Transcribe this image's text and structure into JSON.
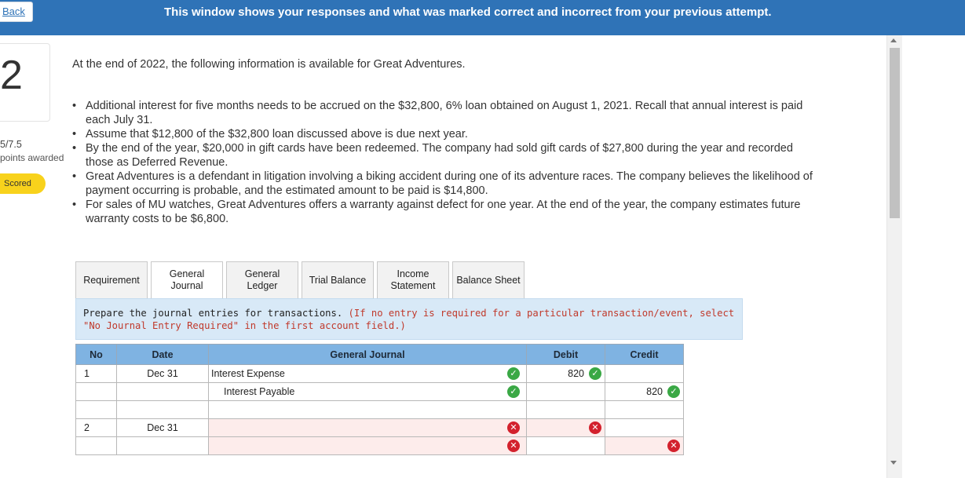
{
  "header": {
    "back_label": "Back",
    "banner": "This window shows your responses and what was marked correct and incorrect from your previous attempt."
  },
  "sidebar": {
    "question_number": "2",
    "score": "5/7.5",
    "points_label": "points awarded",
    "status_badge": "Scored"
  },
  "question": {
    "intro": "At the end of 2022, the following information is available for Great Adventures.",
    "bullets": [
      "Additional interest for five months needs to be accrued on the $32,800, 6% loan obtained on August 1, 2021. Recall that annual interest is paid each July 31.",
      "Assume that $12,800 of the $32,800 loan discussed above is due next year.",
      "By the end of the year, $20,000 in gift cards have been redeemed. The company had sold gift cards of $27,800 during the year and recorded those as Deferred Revenue.",
      "Great Adventures is a defendant in litigation involving a biking accident during one of its adventure races. The company believes the likelihood of payment occurring is probable, and the estimated amount to be paid is $14,800.",
      "For sales of MU watches, Great Adventures offers a warranty against defect for one year. At the end of the year, the company estimates future warranty costs to be $6,800."
    ]
  },
  "tabs": [
    {
      "label": "Requirement"
    },
    {
      "label": "General Journal"
    },
    {
      "label": "General Ledger"
    },
    {
      "label": "Trial Balance"
    },
    {
      "label": "Income Statement"
    },
    {
      "label": "Balance Sheet"
    }
  ],
  "instructions": {
    "main": "Prepare the journal entries for transactions.",
    "note": "(If no entry is required for a particular transaction/event, select \"No Journal Entry Required\" in the first account field.)"
  },
  "journal": {
    "headers": {
      "no": "No",
      "date": "Date",
      "gj": "General Journal",
      "debit": "Debit",
      "credit": "Credit"
    },
    "rows": [
      {
        "no": "1",
        "date": "Dec 31",
        "account": "Interest Expense",
        "debit": "820",
        "credit": ""
      },
      {
        "no": "",
        "date": "",
        "account": "Interest Payable",
        "debit": "",
        "credit": "820"
      },
      {
        "no": "",
        "date": "",
        "account": "",
        "debit": "",
        "credit": ""
      },
      {
        "no": "2",
        "date": "Dec 31",
        "account": "",
        "debit": "",
        "credit": ""
      },
      {
        "no": "",
        "date": "",
        "account": "",
        "debit": "",
        "credit": ""
      }
    ]
  },
  "colors": {
    "topbar": "#2f73b7",
    "badge": "#f8d21c",
    "correct": "#3aa845",
    "incorrect": "#d3212d",
    "table_header": "#7fb3e2"
  }
}
